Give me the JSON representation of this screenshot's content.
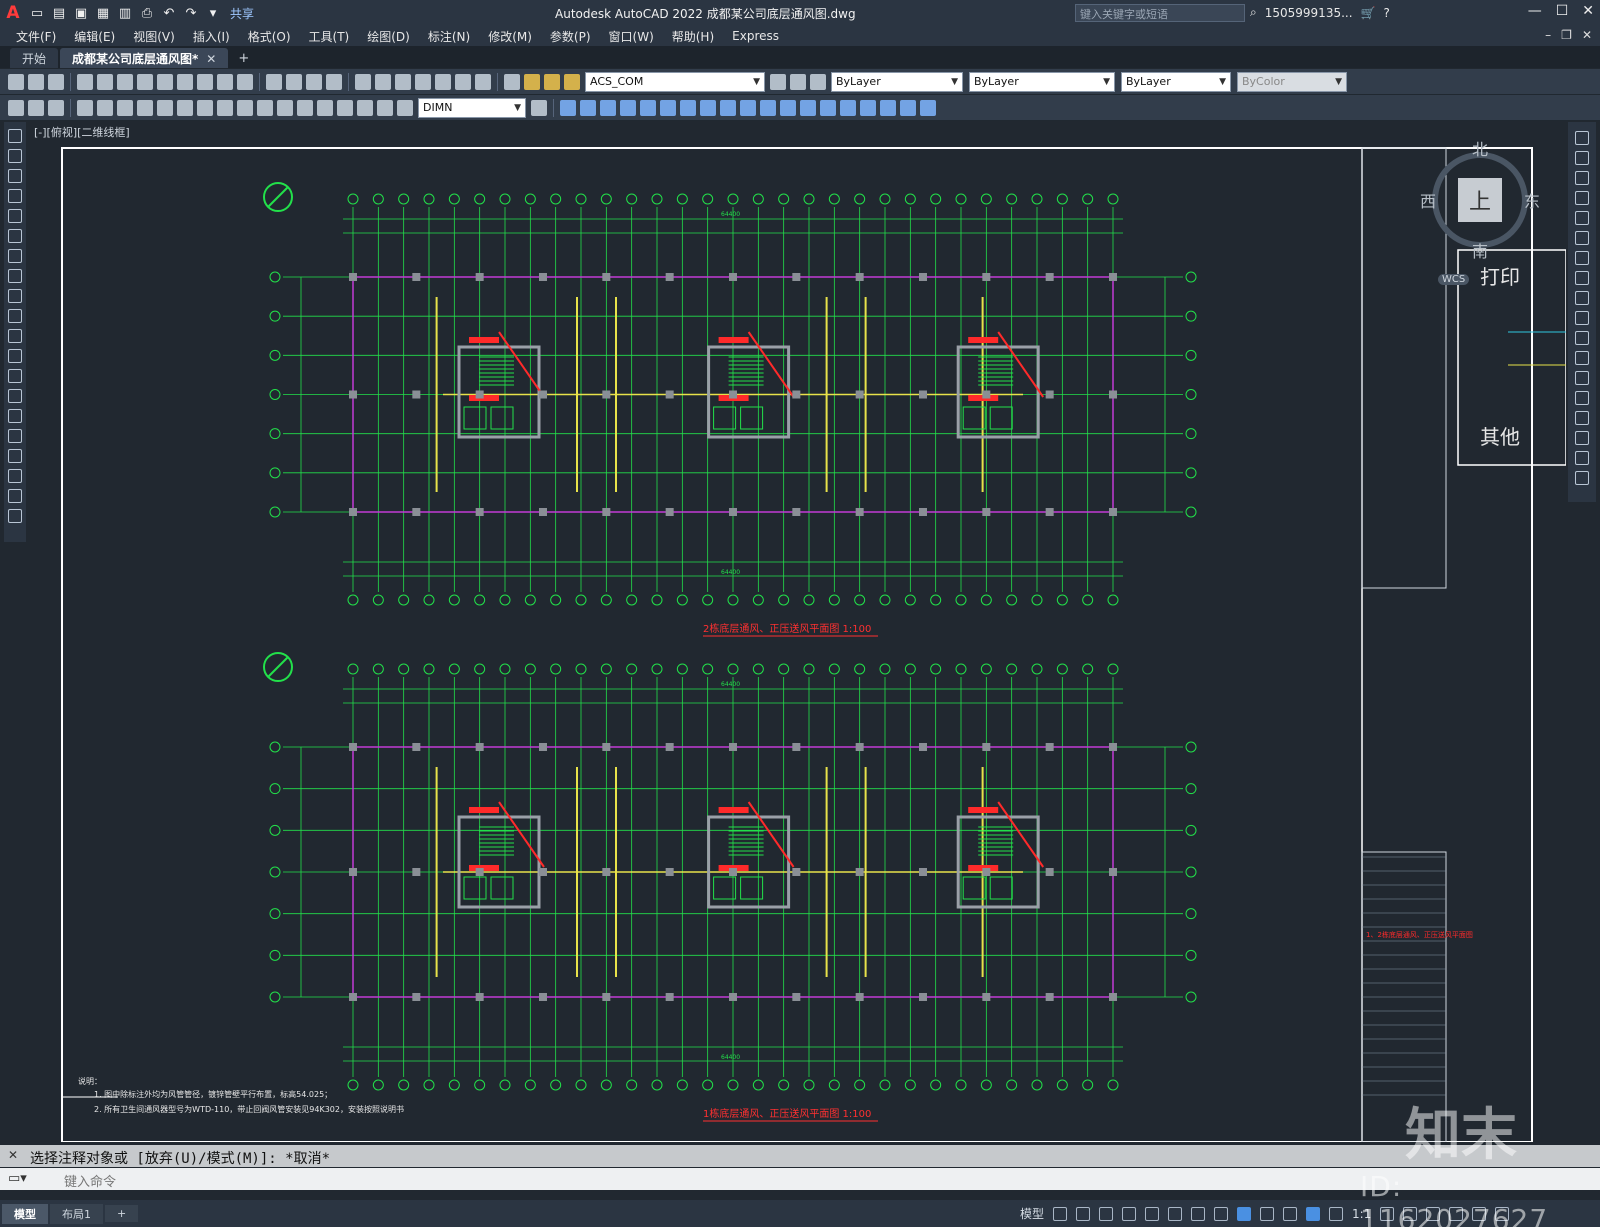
{
  "app": {
    "logo": "A",
    "title": "Autodesk AutoCAD 2022    成都某公司底层通风图.dwg",
    "share_label": "共享",
    "search_placeholder": "键入关键字或短语",
    "user": "1505999135...",
    "window_controls": [
      "—",
      "☐",
      "✕"
    ]
  },
  "menu": [
    "文件(F)",
    "编辑(E)",
    "视图(V)",
    "插入(I)",
    "格式(O)",
    "工具(T)",
    "绘图(D)",
    "标注(N)",
    "修改(M)",
    "参数(P)",
    "窗口(W)",
    "帮助(H)",
    "Express"
  ],
  "tabs": [
    {
      "label": "开始",
      "active": false
    },
    {
      "label": "成都某公司底层通风图*",
      "active": true
    }
  ],
  "toolbar1": {
    "layer_combo": "ACS_COM",
    "color_combo": "ByLayer",
    "linetype_combo": "ByLayer",
    "lineweight_combo": "ByLayer",
    "plotstyle_combo": "ByColor"
  },
  "toolbar2": {
    "dimstyle_combo": "DIMN"
  },
  "canvas": {
    "view_label": "[-][俯视][二维线框]",
    "plan_top_title": "2栋底层通风、正压送风平面图 1:100",
    "plan_bottom_title": "1栋底层通风、正压送风平面图 1:100",
    "dim_overall": "64400",
    "notes_heading": "说明：",
    "notes": [
      "1. 图中除标注外均为风管管径，镀锌管壁平行布置，标高54.025；",
      "2. 所有卫生间通风器型号为WTD-110，带止回阀风管安装见94K302，安装按照说明书"
    ],
    "right_panel_title_red": "1、2栋底层通风、正压送风平面图",
    "side_labels": [
      "打印",
      "其他"
    ],
    "navcube": {
      "north": "北",
      "south": "南",
      "east": "东",
      "west": "西",
      "face": "上",
      "wcs": "WCS"
    }
  },
  "command": {
    "history": "选择注释对象或 [放弃(U)/模式(M)]: *取消*",
    "placeholder": "键入命令"
  },
  "status": {
    "layout_tabs": [
      {
        "label": "模型",
        "active": true
      },
      {
        "label": "布局1",
        "active": false
      }
    ],
    "model_label": "模型",
    "scale": "1:1"
  },
  "watermark": {
    "id_text": "ID: 1162027627",
    "logo_text": "知末"
  },
  "colors": {
    "bg": "#212830",
    "grid_green": "#22e04a",
    "wall_yellow": "#e8e24a",
    "wall_magenta": "#c23ad6",
    "duct_red": "#ff2a2a",
    "column_gray": "#8a8f96",
    "frame_white": "#ffffff"
  }
}
